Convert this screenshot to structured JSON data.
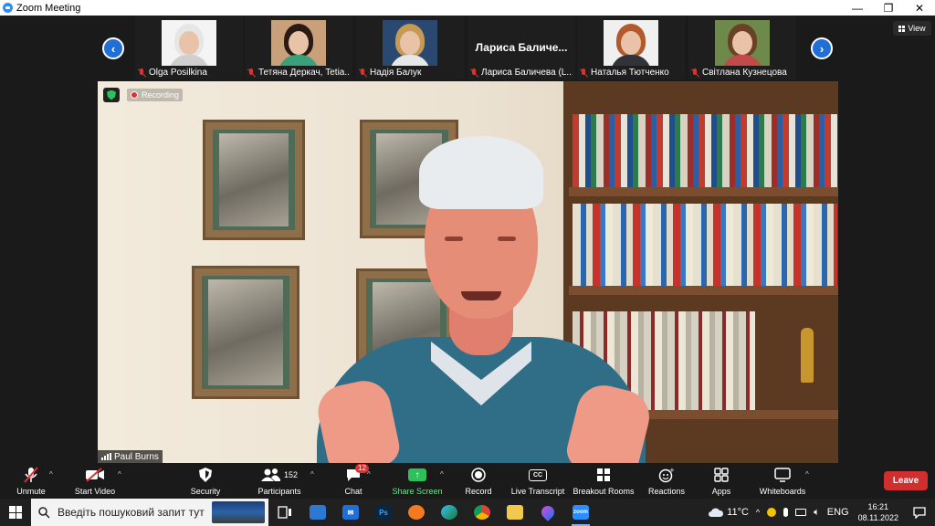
{
  "window": {
    "title": "Zoom Meeting",
    "minimize": "—",
    "restore": "❐",
    "close": "✕"
  },
  "strip": {
    "prev": "‹",
    "next": "›",
    "view_label": "View",
    "participants": [
      {
        "label": "Olga Posilkina",
        "photo": true,
        "hair": "#e6e6e6",
        "shirt": "#cfcfcf",
        "bg": "#f4f4f4"
      },
      {
        "label": "Тетяна Деркач, Tetia...",
        "photo": true,
        "hair": "#2a1a14",
        "shirt": "#3aa07a",
        "bg": "#c9a079"
      },
      {
        "label": "Надія Балук",
        "photo": true,
        "hair": "#c49a55",
        "shirt": "#e7e7e7",
        "bg": "#2a4870"
      },
      {
        "label": "Лариса Баличева (L...",
        "photo": false,
        "display_name": "Лариса Баличе..."
      },
      {
        "label": "Наталья Тютченко",
        "photo": true,
        "hair": "#b25a2b",
        "shirt": "#30333a",
        "bg": "#f0f0f0"
      },
      {
        "label": "Світлана Кузнецова",
        "photo": true,
        "hair": "#6b4025",
        "shirt": "#c24a4a",
        "bg": "#6d8a4a"
      }
    ]
  },
  "video": {
    "recording_label": "Recording",
    "speaker_name": "Paul Burns"
  },
  "toolbar": {
    "unmute": "Unmute",
    "start_video": "Start Video",
    "security": "Security",
    "participants": "Participants",
    "participants_count": "152",
    "chat": "Chat",
    "chat_badge": "12",
    "share_screen": "Share Screen",
    "record": "Record",
    "live_transcript": "Live Transcript",
    "cc": "CC",
    "breakout_rooms": "Breakout Rooms",
    "reactions": "Reactions",
    "apps": "Apps",
    "whiteboards": "Whiteboards",
    "leave": "Leave",
    "caret": "^"
  },
  "taskbar": {
    "search_placeholder": "Введіть пошуковий запит тут",
    "ps_label": "Ps",
    "zoom_label": "zoom",
    "temperature": "11°C",
    "language": "ENG",
    "time": "16:21",
    "date": "08.11.2022"
  },
  "colors": {
    "accent": "#2d8cff",
    "leave": "#d02f2f",
    "share": "#2ec05a",
    "mic_off": "#e02f2f"
  }
}
